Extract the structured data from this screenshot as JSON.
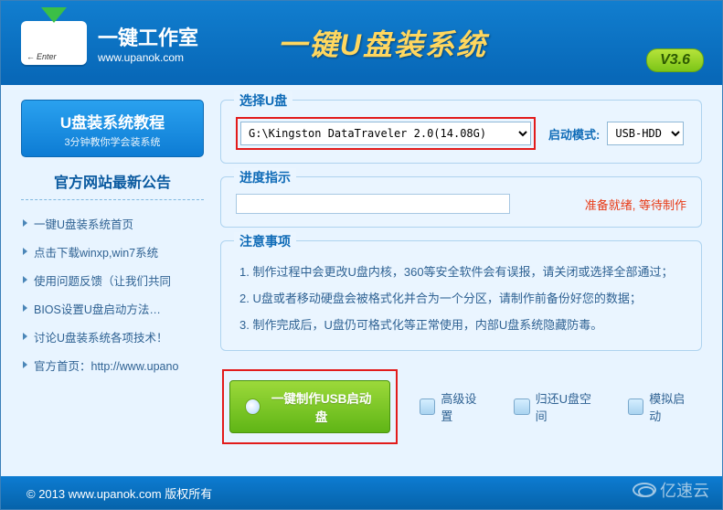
{
  "titlebar": {
    "min": "—",
    "close": "✕"
  },
  "header": {
    "brand": "一键工作室",
    "url": "www.upanok.com",
    "enter": "Enter",
    "app_title": "一键U盘装系统",
    "version": "V3.6"
  },
  "sidebar": {
    "tutorial_title": "U盘装系统教程",
    "tutorial_sub": "3分钟教你学会装系统",
    "announce_title": "官方网站最新公告",
    "links": [
      "一键U盘装系统首页",
      "点击下载winxp,win7系统",
      "使用问题反馈（让我们共同",
      "BIOS设置U盘启动方法…",
      "讨论U盘装系统各项技术！",
      "官方首页：http://www.upano"
    ]
  },
  "usb": {
    "section_title": "选择U盘",
    "drive": "G:\\Kingston DataTraveler 2.0(14.08G)",
    "mode_label": "启动模式:",
    "mode_value": "USB-HDD"
  },
  "progress": {
    "section_title": "进度指示",
    "status": "准备就绪, 等待制作"
  },
  "notes": {
    "section_title": "注意事项",
    "items": [
      "制作过程中会更改U盘内核，360等安全软件会有误报，请关闭或选择全部通过；",
      "U盘或者移动硬盘会被格式化并合为一个分区，请制作前备份好您的数据；",
      "制作完成后，U盘仍可格式化等正常使用，内部U盘系统隐藏防毒。"
    ]
  },
  "actions": {
    "primary": "一键制作USB启动盘",
    "advanced": "高级设置",
    "restore": "归还U盘空间",
    "simulate": "模拟启动"
  },
  "footer": "© 2013 www.upanok.com   版权所有",
  "watermark": "亿速云"
}
